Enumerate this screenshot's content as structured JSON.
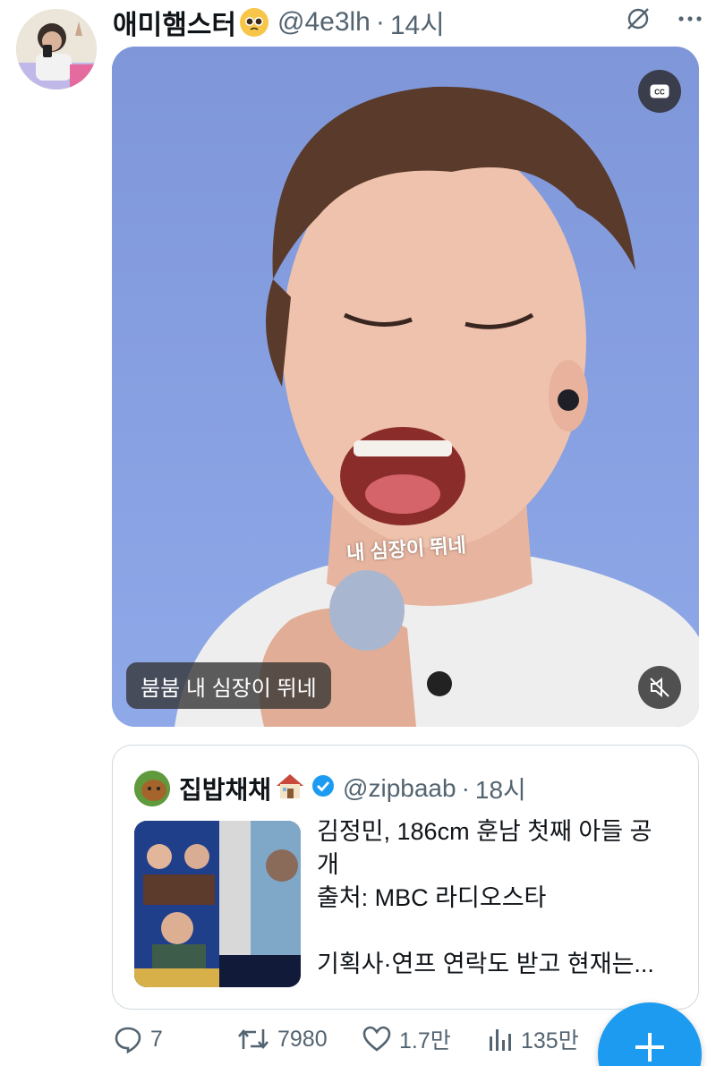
{
  "tweet": {
    "display_name": "애미햄스터",
    "emoji_icon": "pleading-face-emoji",
    "handle": "@4e3lh",
    "separator": "·",
    "time": "14시",
    "header_icons": [
      "grok-icon",
      "more-icon"
    ],
    "media": {
      "cc_icon_label": "CC",
      "on_screen_subtitle": "내 심장이 뛰네",
      "caption": "붐붐 내 심장이 뛰네",
      "mute_icon": "muted-speaker-icon"
    }
  },
  "quote": {
    "display_name": "집밥채채",
    "name_emoji": "house-emoji",
    "verified": true,
    "verified_color": "#1d9bf0",
    "handle": "@zipbaab",
    "separator": "·",
    "time": "18시",
    "text_lines": [
      "김정민, 186cm 훈남 첫째 아들 공",
      "개",
      "출처: MBC 라디오스타",
      "",
      "기획사·연프 연락도 받고 현재는..."
    ]
  },
  "actions": {
    "reply_count": "7",
    "retweet_count": "7980",
    "like_count": "1.7만",
    "views_count": "135만"
  },
  "fab": {
    "icon": "compose-plus-icon",
    "color": "#1d9bf0"
  },
  "colors": {
    "secondary_text": "#536471",
    "border": "#cfd9de",
    "accent": "#1d9bf0"
  }
}
